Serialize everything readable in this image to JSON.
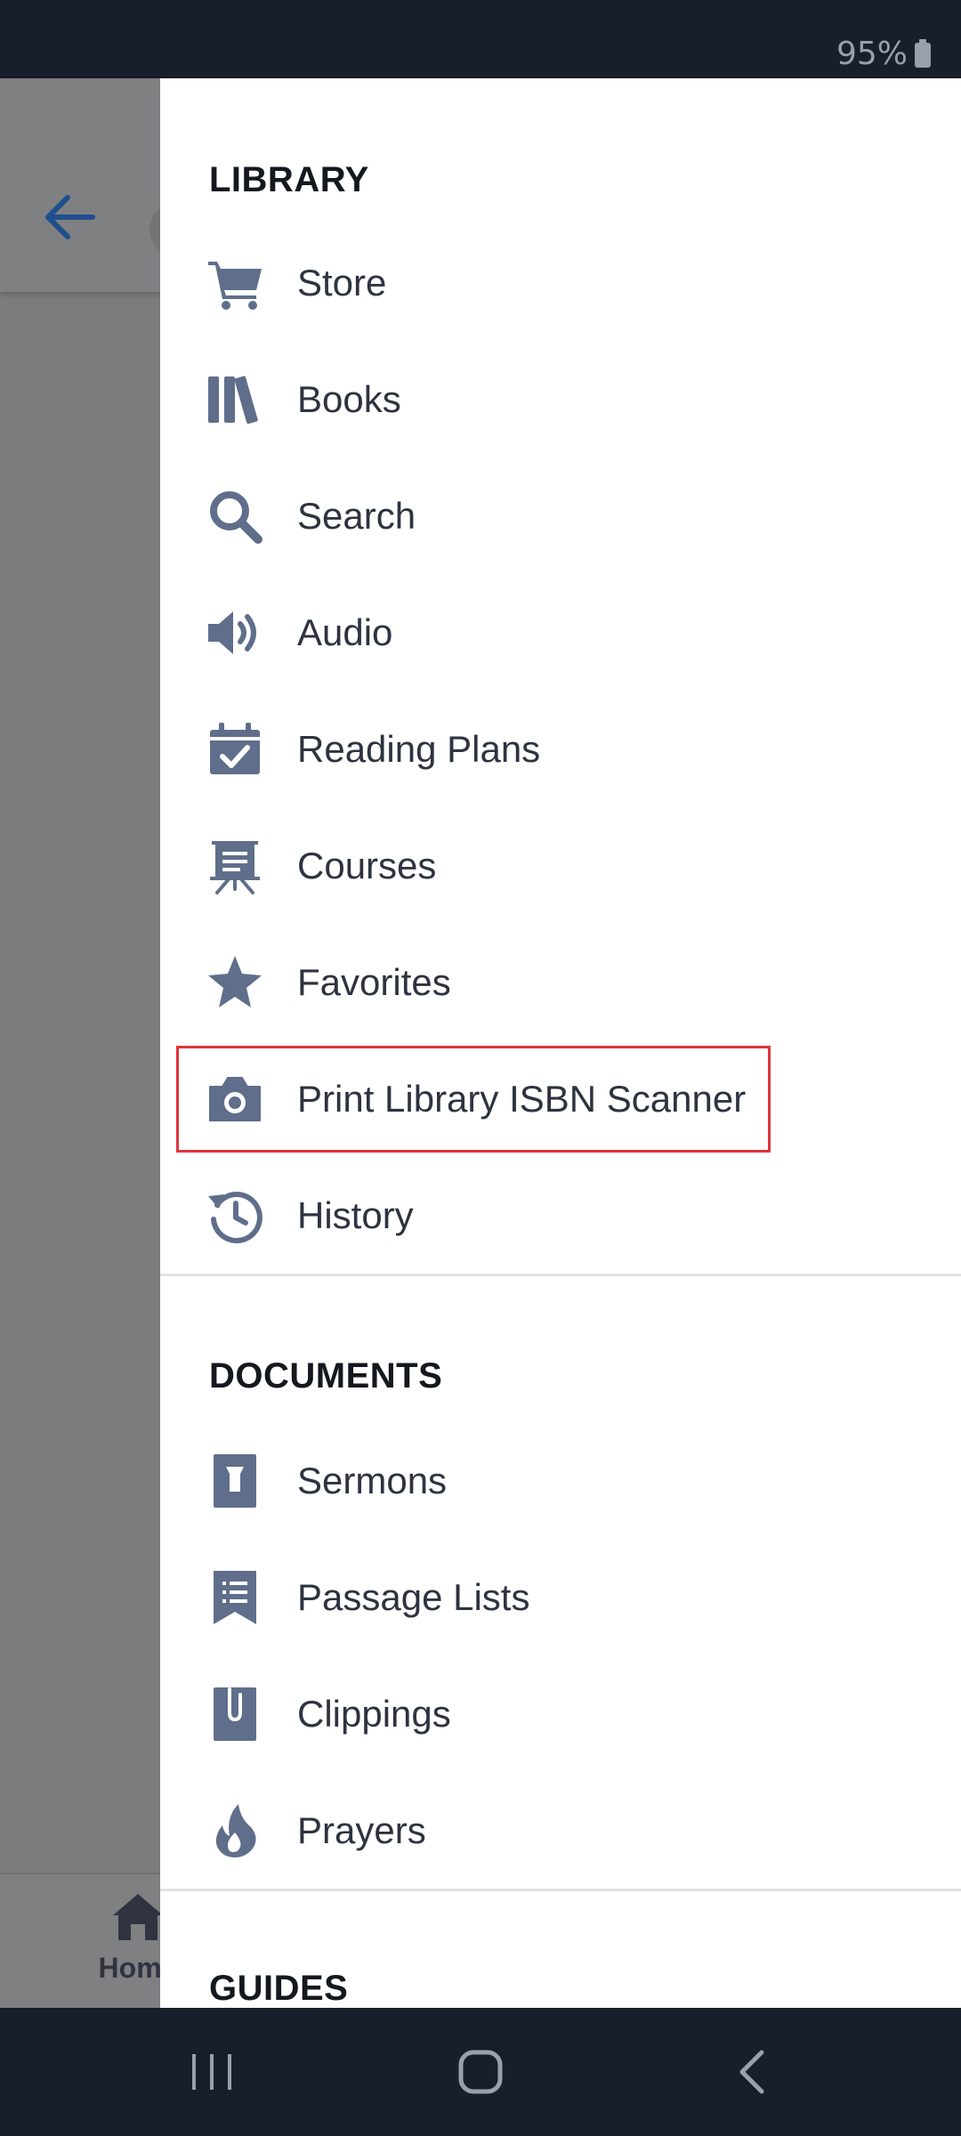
{
  "status_bar": {
    "battery_text": "95%"
  },
  "background": {
    "bottom_tab_home": "Home"
  },
  "drawer": {
    "sections": {
      "library": {
        "title": "LIBRARY",
        "items": [
          {
            "label": "Store",
            "icon": "cart-icon"
          },
          {
            "label": "Books",
            "icon": "books-icon"
          },
          {
            "label": "Search",
            "icon": "search-icon"
          },
          {
            "label": "Audio",
            "icon": "speaker-icon"
          },
          {
            "label": "Reading Plans",
            "icon": "calendar-check-icon"
          },
          {
            "label": "Courses",
            "icon": "easel-icon"
          },
          {
            "label": "Favorites",
            "icon": "star-icon"
          },
          {
            "label": "Print Library ISBN Scanner",
            "icon": "camera-icon",
            "highlighted": true
          },
          {
            "label": "History",
            "icon": "history-icon"
          }
        ]
      },
      "documents": {
        "title": "DOCUMENTS",
        "items": [
          {
            "label": "Sermons",
            "icon": "pulpit-icon"
          },
          {
            "label": "Passage Lists",
            "icon": "bookmark-list-icon"
          },
          {
            "label": "Clippings",
            "icon": "clipping-icon"
          },
          {
            "label": "Prayers",
            "icon": "flame-icon"
          }
        ]
      },
      "guides": {
        "title": "GUIDES"
      }
    }
  },
  "colors": {
    "icon": "#5f6e8a",
    "text": "#2d3340",
    "highlight": "#e0343c",
    "accent": "#1f4f8c"
  }
}
